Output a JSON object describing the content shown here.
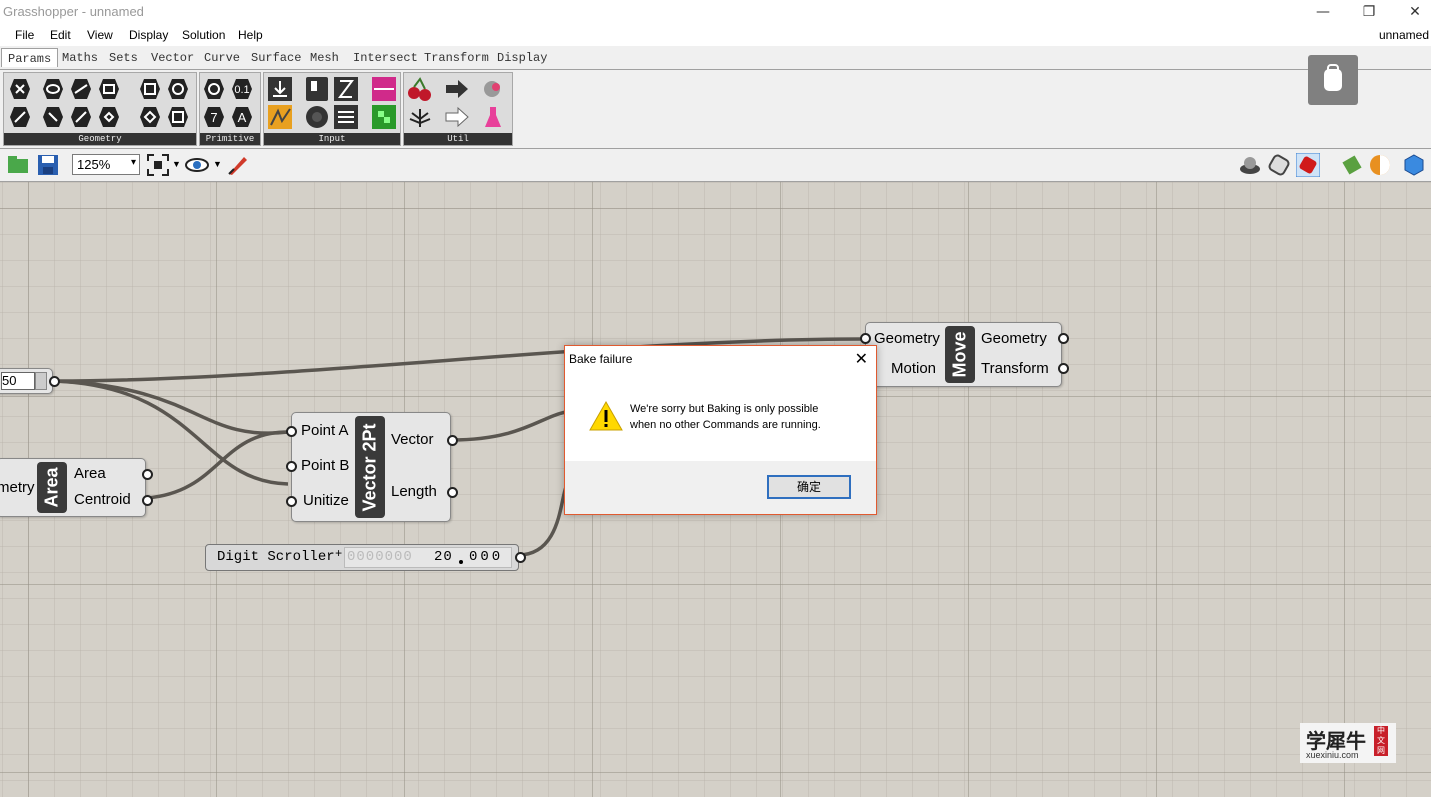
{
  "window": {
    "title": "Grasshopper - unnamed",
    "min": "—",
    "restore": "❐",
    "close": "✕"
  },
  "menu": {
    "items": [
      "File",
      "Edit",
      "View",
      "Display",
      "Solution",
      "Help"
    ],
    "doc_name": "unnamed"
  },
  "tabs": [
    "Params",
    "Maths",
    "Sets",
    "Vector",
    "Curve",
    "Surface",
    "Mesh",
    "Intersect",
    "Transform",
    "Display"
  ],
  "ribbon": {
    "panels": [
      "Geometry",
      "Primitive",
      "Input",
      "Util"
    ],
    "prim_labels": {
      "number": "0.1",
      "integer": "7",
      "text": "A"
    }
  },
  "toolbar": {
    "zoom": "125%"
  },
  "components": {
    "move": {
      "nickname": "Move",
      "inputs": [
        "Geometry",
        "Motion"
      ],
      "outputs": [
        "Geometry",
        "Transform"
      ]
    },
    "vector2pt": {
      "nickname": "Vector 2Pt",
      "inputs": [
        "Point A",
        "Point B",
        "Unitize"
      ],
      "outputs": [
        "Vector",
        "Length"
      ]
    },
    "area": {
      "nickname": "Area",
      "input_partial": "metry",
      "outputs": [
        "Area",
        "Centroid"
      ]
    },
    "slider": {
      "value": "50"
    },
    "digit_scroller": {
      "label": "Digit Scroller",
      "sign": "+",
      "faded_digits": "0000000",
      "int_digits": "20",
      "dec_digits": "000"
    }
  },
  "dialog": {
    "title": "Bake failure",
    "message_line1": "We're sorry but Baking is only possible",
    "message_line2": "when no other Commands are running.",
    "ok_label": "确定",
    "close": "✕"
  },
  "watermark": {
    "cn": "学犀牛",
    "badge": "中文网",
    "url": "xuexiniu.com"
  }
}
